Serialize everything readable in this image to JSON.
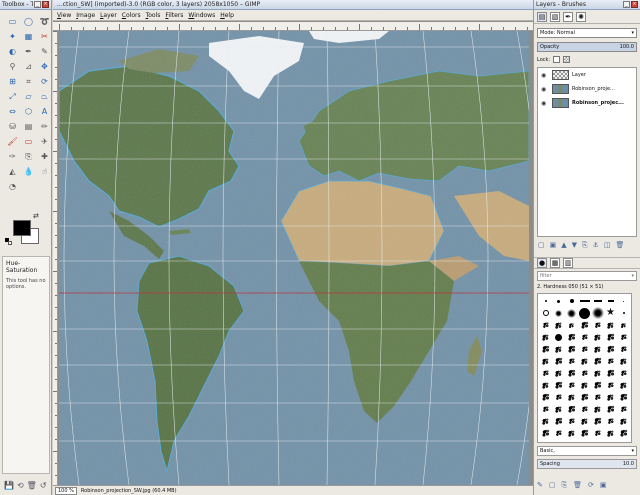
{
  "toolbox": {
    "title": "Toolbox - To...",
    "tools": [
      {
        "name": "rect-select-icon",
        "glyph": "▭",
        "color": "c-blue"
      },
      {
        "name": "ellipse-select-icon",
        "glyph": "◯",
        "color": "c-blue"
      },
      {
        "name": "free-select-icon",
        "glyph": "➰",
        "color": "c-blue"
      },
      {
        "name": "fuzzy-select-icon",
        "glyph": "✦",
        "color": "c-blue"
      },
      {
        "name": "select-by-color-icon",
        "glyph": "▦",
        "color": "c-blue"
      },
      {
        "name": "scissors-select-icon",
        "glyph": "✂",
        "color": "c-red"
      },
      {
        "name": "foreground-select-icon",
        "glyph": "◐",
        "color": "c-blue"
      },
      {
        "name": "paths-icon",
        "glyph": "✒",
        "color": "c-gray"
      },
      {
        "name": "color-picker-icon",
        "glyph": "✎",
        "color": "c-gray"
      },
      {
        "name": "zoom-icon",
        "glyph": "⚲",
        "color": "c-gray"
      },
      {
        "name": "measure-icon",
        "glyph": "⊿",
        "color": "c-gray"
      },
      {
        "name": "move-icon",
        "glyph": "✥",
        "color": "c-blue"
      },
      {
        "name": "align-icon",
        "glyph": "⊞",
        "color": "c-blue"
      },
      {
        "name": "crop-icon",
        "glyph": "⌗",
        "color": "c-gray"
      },
      {
        "name": "rotate-icon",
        "glyph": "⟳",
        "color": "c-blue"
      },
      {
        "name": "scale-icon",
        "glyph": "⤢",
        "color": "c-blue"
      },
      {
        "name": "shear-icon",
        "glyph": "▱",
        "color": "c-blue"
      },
      {
        "name": "perspective-icon",
        "glyph": "⏢",
        "color": "c-blue"
      },
      {
        "name": "flip-icon",
        "glyph": "⇔",
        "color": "c-blue"
      },
      {
        "name": "cage-icon",
        "glyph": "⬡",
        "color": "c-blue"
      },
      {
        "name": "text-icon",
        "glyph": "A",
        "color": "c-blue"
      },
      {
        "name": "bucket-fill-icon",
        "glyph": "⛁",
        "color": "c-gray"
      },
      {
        "name": "blend-icon",
        "glyph": "▤",
        "color": "c-gray"
      },
      {
        "name": "pencil-icon",
        "glyph": "✏",
        "color": "c-gray"
      },
      {
        "name": "paintbrush-icon",
        "glyph": "🖌",
        "color": "c-red"
      },
      {
        "name": "eraser-icon",
        "glyph": "▭",
        "color": "c-red"
      },
      {
        "name": "airbrush-icon",
        "glyph": "✈",
        "color": "c-gray"
      },
      {
        "name": "ink-icon",
        "glyph": "✑",
        "color": "c-gray"
      },
      {
        "name": "clone-icon",
        "glyph": "⎘",
        "color": "c-gray"
      },
      {
        "name": "heal-icon",
        "glyph": "✚",
        "color": "c-gray"
      },
      {
        "name": "perspective-clone-icon",
        "glyph": "◭",
        "color": "c-gray"
      },
      {
        "name": "blur-icon",
        "glyph": "💧",
        "color": "c-blue"
      },
      {
        "name": "smudge-icon",
        "glyph": "☝",
        "color": "c-gray"
      },
      {
        "name": "dodge-burn-icon",
        "glyph": "◔",
        "color": "c-gray"
      }
    ],
    "options_title": "Hue-Saturation",
    "options_message": "This tool has no options."
  },
  "image_window": {
    "title": "...ction_SW] (imported)-3.0 (RGB color, 3 layers) 2058x1050 – GIMP",
    "menus": [
      "View",
      "Image",
      "Layer",
      "Colors",
      "Tools",
      "Filters",
      "Windows",
      "Help"
    ],
    "zoom": "100 %",
    "status": "Robinson_projection_SW.jpg (60.4 MB)"
  },
  "dock": {
    "title": "Layers - Brushes",
    "mode_label": "Mode:",
    "mode_value": "Normal",
    "opacity_label": "Opacity",
    "opacity_value": "100.0",
    "lock_label": "Lock:",
    "layers": [
      {
        "name": "Layer",
        "thumb": "check"
      },
      {
        "name": "Robinson_proje...",
        "thumb": "map"
      },
      {
        "name": "Robinson_projec...",
        "thumb": "map"
      }
    ],
    "filter_placeholder": "filter",
    "brush_name": "2. Hardness 050 (51 × 51)",
    "preset": "Basic,",
    "spacing_label": "Spacing",
    "spacing_value": "10.0"
  },
  "colors": {
    "ocean": "#6f90a8",
    "land_green": "#55743e",
    "land_desert": "#c8ab7a",
    "ice": "#f2f5f8",
    "shallow": "#4aa8d8",
    "graticule": "#e8eef2",
    "guide": "#b83a3a"
  }
}
